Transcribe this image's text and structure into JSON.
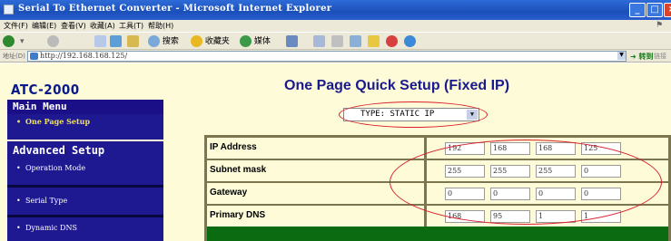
{
  "window": {
    "title": "Serial To Ethernet Converter - Microsoft Internet Explorer"
  },
  "menu": [
    "文件(F)",
    "编辑(E)",
    "查看(V)",
    "收藏(A)",
    "工具(T)",
    "帮助(H)"
  ],
  "toolbar": {
    "back": "",
    "search": "搜索",
    "favorites": "收藏夹",
    "media": "媒体"
  },
  "address": {
    "label": "地址(D)",
    "url": "http://192.168.168.125/",
    "go": "转到",
    "links": "链接"
  },
  "sidebar": {
    "logo": "ATC-2000",
    "main_menu": "Main Menu",
    "main_items": [
      "One Page Setup"
    ],
    "advanced": "Advanced Setup",
    "advanced_items": [
      "Operation Mode",
      "Serial Type",
      "Dynamic DNS"
    ]
  },
  "main": {
    "title": "One Page Quick Setup (Fixed IP)",
    "type_select": "TYPE: STATIC IP",
    "rows": [
      {
        "label": "IP Address",
        "octets": [
          "192",
          "168",
          "168",
          "125"
        ]
      },
      {
        "label": "Subnet mask",
        "octets": [
          "255",
          "255",
          "255",
          "0"
        ]
      },
      {
        "label": "Gateway",
        "octets": [
          "0",
          "0",
          "0",
          "0"
        ]
      },
      {
        "label": "Primary DNS",
        "octets": [
          "168",
          "95",
          "1",
          "1"
        ]
      }
    ]
  },
  "colors": {
    "sidebar_nav": "#1e1891",
    "page_bg": "#fdfbd8",
    "title": "#1a1a8c",
    "annotation": "#d81e2a",
    "footer_bar": "#0a6b10"
  }
}
